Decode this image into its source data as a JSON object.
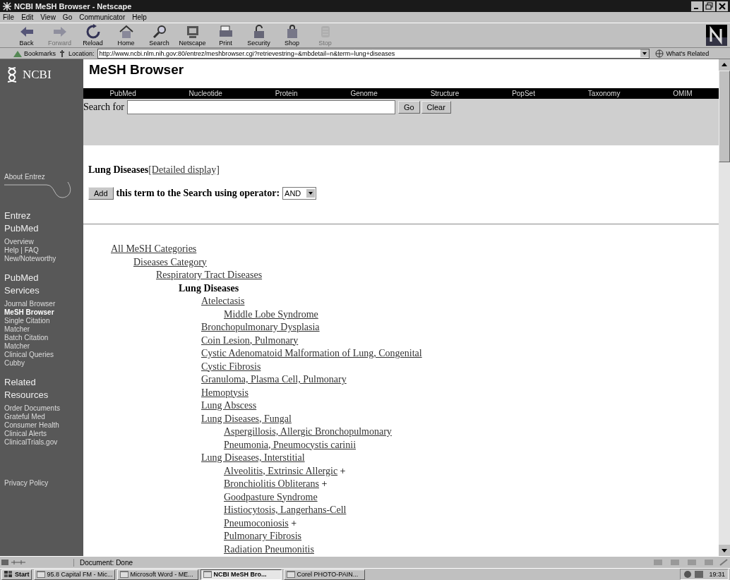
{
  "window": {
    "title": "NCBI MeSH Browser - Netscape"
  },
  "menu": [
    "File",
    "Edit",
    "View",
    "Go",
    "Communicator",
    "Help"
  ],
  "toolbar": [
    {
      "label": "Back",
      "disabled": false
    },
    {
      "label": "Forward",
      "disabled": true
    },
    {
      "label": "Reload",
      "disabled": false
    },
    {
      "label": "Home",
      "disabled": false
    },
    {
      "label": "Search",
      "disabled": false
    },
    {
      "label": "Netscape",
      "disabled": false
    },
    {
      "label": "Print",
      "disabled": false
    },
    {
      "label": "Security",
      "disabled": false
    },
    {
      "label": "Shop",
      "disabled": false
    },
    {
      "label": "Stop",
      "disabled": true
    }
  ],
  "location_bar": {
    "bookmarks": "Bookmarks",
    "label": "Location:",
    "url": "http://www.ncbi.nlm.nih.gov:80/entrez/meshbrowser.cgi?retrievestring=&mbdetail=n&term=lung+diseases",
    "related": "What's Related"
  },
  "page": {
    "logo": "NCBI",
    "title": "MeSH Browser",
    "nav": [
      "PubMed",
      "Nucleotide",
      "Protein",
      "Genome",
      "Structure",
      "PopSet",
      "Taxonomy",
      "OMIM"
    ],
    "search": {
      "label": "Search for",
      "go": "Go",
      "clear": "Clear"
    },
    "term": {
      "name": "Lung Diseases",
      "detail_link": "[Detailed display]"
    },
    "add": {
      "button": "Add",
      "text": "this term to the Search using operator:",
      "operator": "AND"
    },
    "sidebar": {
      "about": "About Entrez",
      "sections": [
        {
          "heading": "Entrez PubMed",
          "links": [
            {
              "label": "Overview",
              "selected": false
            },
            {
              "label": "Help | FAQ",
              "selected": false
            },
            {
              "label": "New/Noteworthy",
              "selected": false
            }
          ]
        },
        {
          "heading": "PubMed Services",
          "links": [
            {
              "label": "Journal Browser",
              "selected": false
            },
            {
              "label": "MeSH Browser",
              "selected": true
            },
            {
              "label": "Single Citation Matcher",
              "selected": false
            },
            {
              "label": "Batch Citation Matcher",
              "selected": false
            },
            {
              "label": "Clinical Queries",
              "selected": false
            },
            {
              "label": "Cubby",
              "selected": false
            }
          ]
        },
        {
          "heading": "Related Resources",
          "links": [
            {
              "label": "Order Documents",
              "selected": false
            },
            {
              "label": "Grateful Med",
              "selected": false
            },
            {
              "label": "Consumer Health",
              "selected": false
            },
            {
              "label": "Clinical Alerts",
              "selected": false
            },
            {
              "label": "ClinicalTrials.gov",
              "selected": false
            }
          ]
        }
      ],
      "privacy": "Privacy Policy"
    },
    "tree": [
      {
        "label": "All MeSH Categories",
        "kind": "link",
        "children": [
          {
            "label": "Diseases Category",
            "kind": "link",
            "children": [
              {
                "label": "Respiratory Tract Diseases",
                "kind": "link",
                "children": [
                  {
                    "label": "Lung Diseases",
                    "kind": "current",
                    "children": [
                      {
                        "label": "Atelectasis",
                        "kind": "link",
                        "children": [
                          {
                            "label": "Middle Lobe Syndrome",
                            "kind": "link"
                          }
                        ]
                      },
                      {
                        "label": "Bronchopulmonary Dysplasia",
                        "kind": "link"
                      },
                      {
                        "label": "Coin Lesion, Pulmonary",
                        "kind": "link"
                      },
                      {
                        "label": "Cystic Adenomatoid Malformation of Lung, Congenital",
                        "kind": "link"
                      },
                      {
                        "label": "Cystic Fibrosis",
                        "kind": "link"
                      },
                      {
                        "label": "Granuloma, Plasma Cell, Pulmonary",
                        "kind": "link"
                      },
                      {
                        "label": "Hemoptysis",
                        "kind": "link"
                      },
                      {
                        "label": "Lung Abscess",
                        "kind": "link"
                      },
                      {
                        "label": "Lung Diseases, Fungal",
                        "kind": "link",
                        "children": [
                          {
                            "label": "Aspergillosis, Allergic Bronchopulmonary",
                            "kind": "link"
                          },
                          {
                            "label": "Pneumonia, Pneumocystis carinii",
                            "kind": "link"
                          }
                        ]
                      },
                      {
                        "label": "Lung Diseases, Interstitial",
                        "kind": "link",
                        "children": [
                          {
                            "label": "Alveolitis, Extrinsic Allergic",
                            "kind": "link",
                            "more": "+"
                          },
                          {
                            "label": "Bronchiolitis Obliterans",
                            "kind": "link",
                            "more": "+"
                          },
                          {
                            "label": "Goodpasture Syndrome",
                            "kind": "link"
                          },
                          {
                            "label": "Histiocytosis, Langerhans-Cell",
                            "kind": "link"
                          },
                          {
                            "label": "Pneumoconiosis",
                            "kind": "link",
                            "more": "+"
                          },
                          {
                            "label": "Pulmonary Fibrosis",
                            "kind": "link"
                          },
                          {
                            "label": "Radiation Pneumonitis",
                            "kind": "link"
                          }
                        ]
                      }
                    ]
                  }
                ]
              }
            ]
          }
        ]
      }
    ]
  },
  "status_bar": {
    "text": "Document: Done"
  },
  "taskbar": {
    "start": "Start",
    "tasks": [
      {
        "label": "95.8 Capital FM - Mic...",
        "selected": false
      },
      {
        "label": "Microsoft Word - ME...",
        "selected": false
      },
      {
        "label": "NCBI MeSH Bro...",
        "selected": true
      },
      {
        "label": "Corel PHOTO-PAIN...",
        "selected": false
      }
    ],
    "clock": "19:31"
  }
}
